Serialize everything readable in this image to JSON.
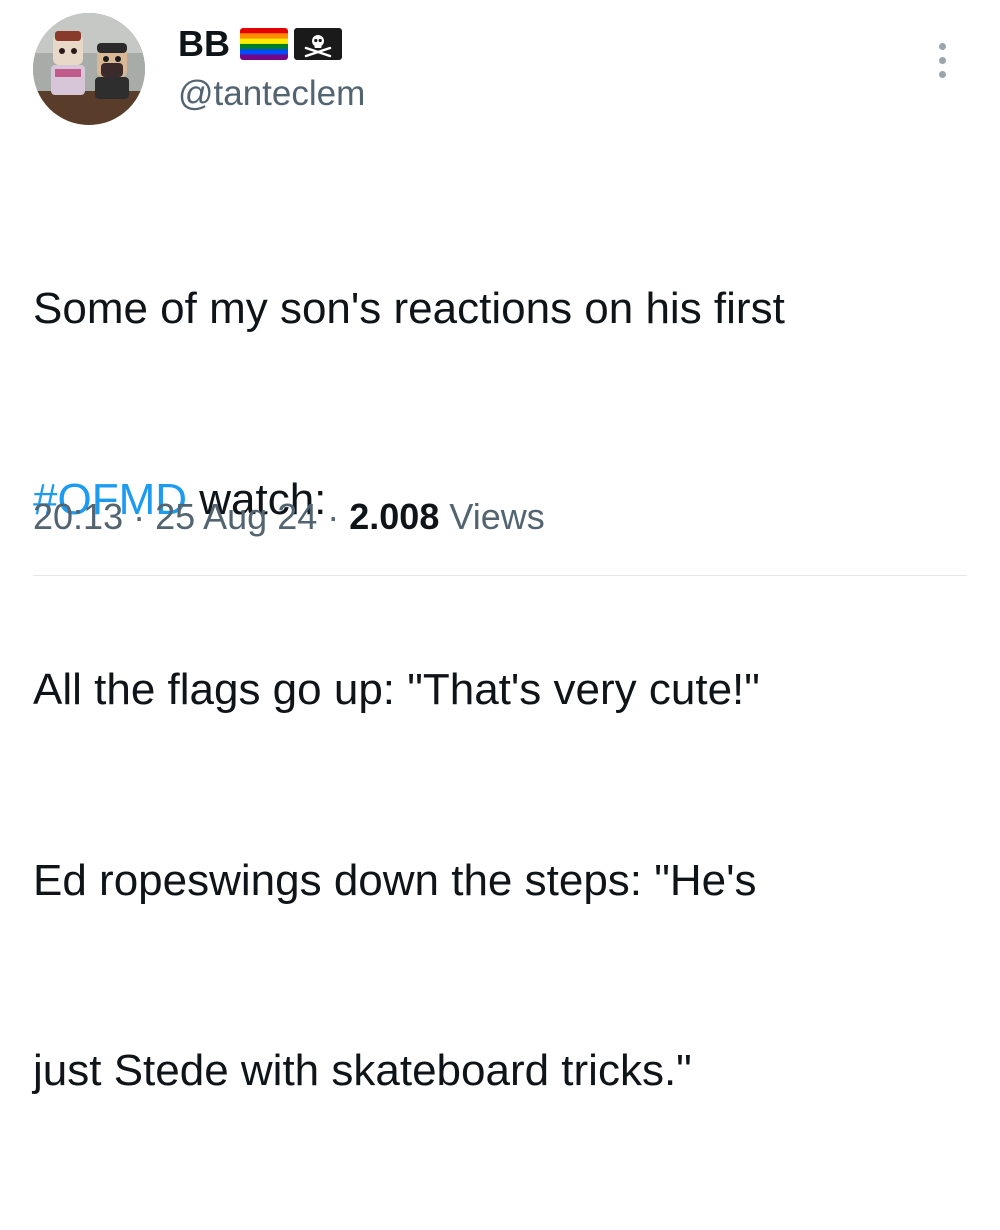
{
  "author": {
    "display_name": "BB",
    "handle": "@tanteclem",
    "badges": [
      "rainbow-flag-icon",
      "pirate-flag-icon"
    ]
  },
  "tweet": {
    "line1": "Some of my son's reactions on his first",
    "hashtag": "#OFMD",
    "line2_rest": " watch:",
    "line3": "All the flags go up: \"That's very cute!\"",
    "line4": "Ed ropeswings down the steps: \"He's",
    "line5": "just Stede with skateboard tricks.\""
  },
  "meta": {
    "time": "20:13",
    "date": "25 Aug 24",
    "views_count": "2.008",
    "views_label": "Views",
    "separator": "·"
  },
  "colors": {
    "hashtag": "#1d9bf0",
    "secondary_text": "#536471",
    "primary_text": "#0f1419"
  }
}
